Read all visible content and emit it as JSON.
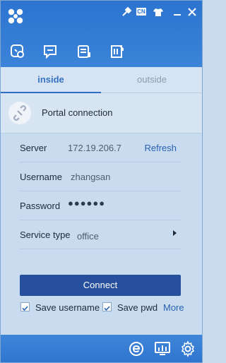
{
  "titlebar": {
    "logo": "app-logo",
    "language_label": "CN",
    "icons": [
      "tools-icon",
      "shirt-icon",
      "minimize-icon",
      "close-icon"
    ]
  },
  "nav": {
    "icons": [
      "connection-icon",
      "message-icon",
      "info-list-icon",
      "notes-icon"
    ]
  },
  "tabs": [
    {
      "label": "inside",
      "active": true
    },
    {
      "label": "outside",
      "active": false
    }
  ],
  "portal": {
    "label": "Portal connection",
    "icon": "broken-link-icon"
  },
  "form": {
    "server_label": "Server",
    "server_value": "172.19.206.7",
    "refresh_label": "Refresh",
    "username_label": "Username",
    "username_value": "zhangsan",
    "password_label": "Password",
    "password_value": "●●●●●●",
    "service_label": "Service type",
    "service_value": "office"
  },
  "connect_label": "Connect",
  "options": {
    "save_username_label": "Save username",
    "save_pwd_label": "Save pwd",
    "more_label": "More"
  },
  "footer": {
    "icons": [
      "browser-e-icon",
      "monitor-chart-icon",
      "gear-icon"
    ]
  },
  "colors": {
    "header": "#2c74cf",
    "accent": "#3572c1",
    "button": "#27509c",
    "link": "#2a62b3",
    "panel": "#c8dbef"
  }
}
